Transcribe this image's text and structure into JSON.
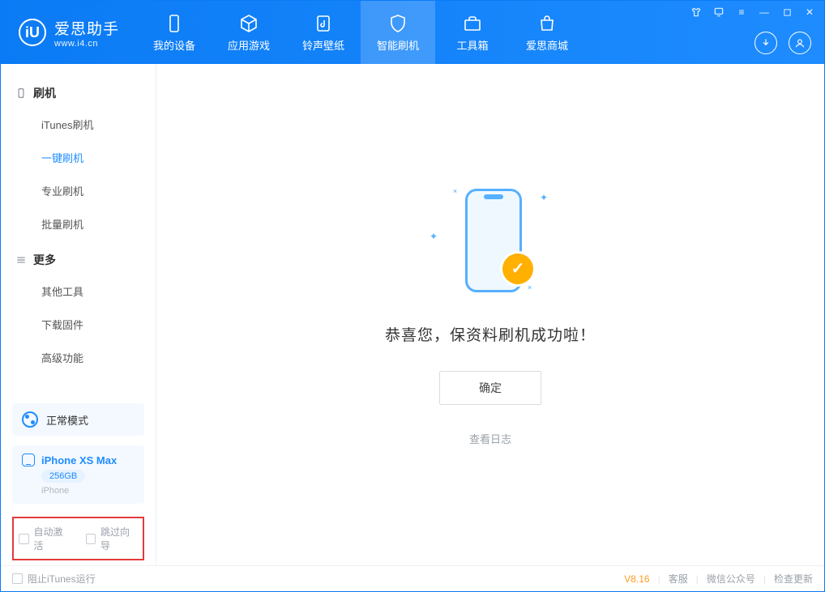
{
  "app": {
    "name": "爱思助手",
    "url": "www.i4.cn"
  },
  "nav": {
    "tabs": [
      {
        "label": "我的设备"
      },
      {
        "label": "应用游戏"
      },
      {
        "label": "铃声壁纸"
      },
      {
        "label": "智能刷机"
      },
      {
        "label": "工具箱"
      },
      {
        "label": "爱思商城"
      }
    ]
  },
  "sidebar": {
    "group1": {
      "title": "刷机",
      "items": [
        "iTunes刷机",
        "一键刷机",
        "专业刷机",
        "批量刷机"
      ]
    },
    "group2": {
      "title": "更多",
      "items": [
        "其他工具",
        "下载固件",
        "高级功能"
      ]
    },
    "mode": "正常模式",
    "device": {
      "name": "iPhone XS Max",
      "capacity": "256GB",
      "type": "iPhone"
    },
    "options": {
      "auto_activate": "自动激活",
      "skip_guide": "跳过向导"
    }
  },
  "main": {
    "success_msg": "恭喜您，保资料刷机成功啦！",
    "ok_label": "确定",
    "log_link": "查看日志"
  },
  "footer": {
    "block_itunes": "阻止iTunes运行",
    "version": "V8.16",
    "service": "客服",
    "wechat": "微信公众号",
    "update": "检查更新"
  }
}
